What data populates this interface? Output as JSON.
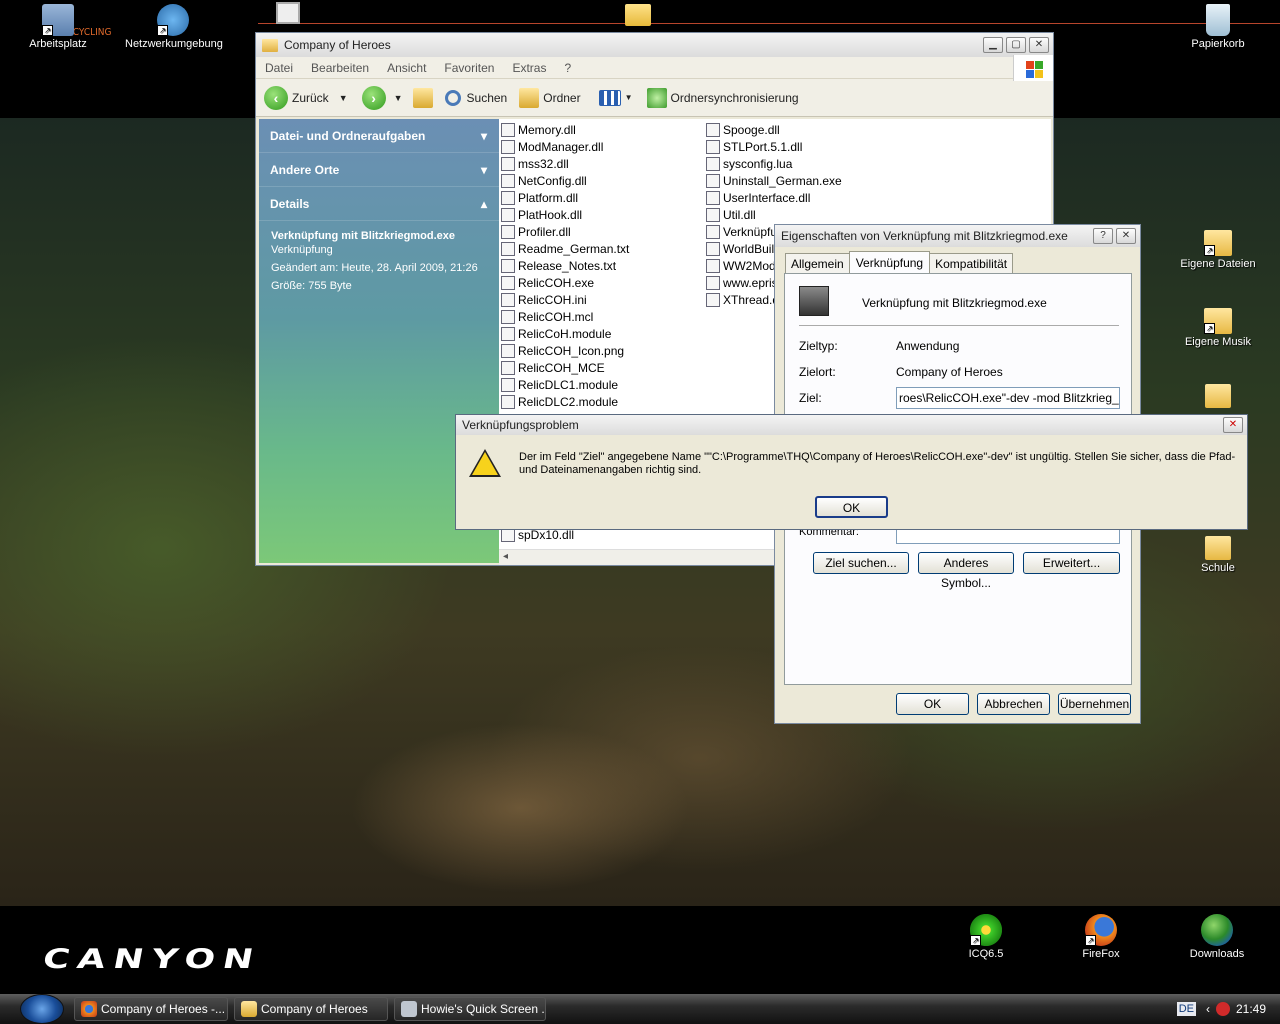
{
  "desktop": {
    "wallpaper_brand": "CANYON",
    "wallpaper_tagline": "PURE CYCLING",
    "icons": {
      "arbeitsplatz": "Arbeitsplatz",
      "netzwerk": "Netzwerkumgebung",
      "papierkorb": "Papierkorb",
      "eigene_dateien": "Eigene Dateien",
      "eigene_musik": "Eigene Musik",
      "schule": "Schule",
      "icq": "ICQ6.5",
      "firefox": "FireFox",
      "downloads": "Downloads"
    }
  },
  "explorer": {
    "title": "Company of Heroes",
    "menu": [
      "Datei",
      "Bearbeiten",
      "Ansicht",
      "Favoriten",
      "Extras",
      "?"
    ],
    "toolbar": {
      "back": "Zurück",
      "search": "Suchen",
      "folders": "Ordner",
      "sync": "Ordnersynchronisierung"
    },
    "sidepanel": {
      "tasks": "Datei- und Ordneraufgaben",
      "other": "Andere Orte",
      "details": "Details",
      "detail_name": "Verknüpfung mit Blitzkriegmod.exe",
      "detail_type": "Verknüpfung",
      "detail_changed": "Geändert am: Heute, 28. April 2009, 21:26",
      "detail_size": "Größe: 755 Byte"
    },
    "files_col1": [
      "Memory.dll",
      "ModManager.dll",
      "mss32.dll",
      "NetConfig.dll",
      "Platform.dll",
      "PlatHook.dll",
      "Profiler.dll",
      "Readme_German.txt",
      "Release_Notes.txt",
      "RelicCOH.exe",
      "RelicCOH.ini",
      "RelicCOH.mcl",
      "RelicCoH.module",
      "RelicCOH_Icon.png",
      "RelicCOH_MCE",
      "RelicDLC1.module",
      "RelicDLC2.module"
    ],
    "files_col1_bottom": "spDx10.dll",
    "files_col2": [
      "Spooge.dll",
      "STLPort.5.1.dll",
      "sysconfig.lua",
      "Uninstall_German.exe",
      "UserInterface.dll",
      "Util.dll",
      "Verknüpfun",
      "WorldBuilde",
      "WW2Mod.d",
      "www.eprisc",
      "XThread.dll"
    ]
  },
  "properties": {
    "title": "Eigenschaften von Verknüpfung mit Blitzkriegmod.exe",
    "tabs": [
      "Allgemein",
      "Verknüpfung",
      "Kompatibilität"
    ],
    "name": "Verknüpfung mit Blitzkriegmod.exe",
    "zieltyp_label": "Zieltyp:",
    "zieltyp": "Anwendung",
    "zielort_label": "Zielort:",
    "zielort": "Company of Heroes",
    "ziel_label": "Ziel:",
    "ziel": "roes\\RelicCOH.exe\"-dev -mod Blitzkrieg_SP",
    "kommentar_label": "Kommentar:",
    "btn_ziel": "Ziel suchen...",
    "btn_symbol": "Anderes Symbol...",
    "btn_erweitert": "Erweitert...",
    "btn_ok": "OK",
    "btn_cancel": "Abbrechen",
    "btn_apply": "Übernehmen"
  },
  "error": {
    "title": "Verknüpfungsproblem",
    "message": "Der im Feld \"Ziel\" angegebene Name \"\"C:\\Programme\\THQ\\Company of Heroes\\RelicCOH.exe\"-dev\" ist ungültig. Stellen Sie sicher, dass die Pfad- und Dateinamenangaben richtig sind.",
    "ok": "OK"
  },
  "taskbar": {
    "tasks": [
      "Company of Heroes -...",
      "Company of Heroes",
      "Howie's Quick Screen ..."
    ],
    "lang": "DE",
    "clock": "21:49"
  },
  "colors": {
    "accent": "#3a6ea5",
    "error_warn": "#f7d21c"
  }
}
